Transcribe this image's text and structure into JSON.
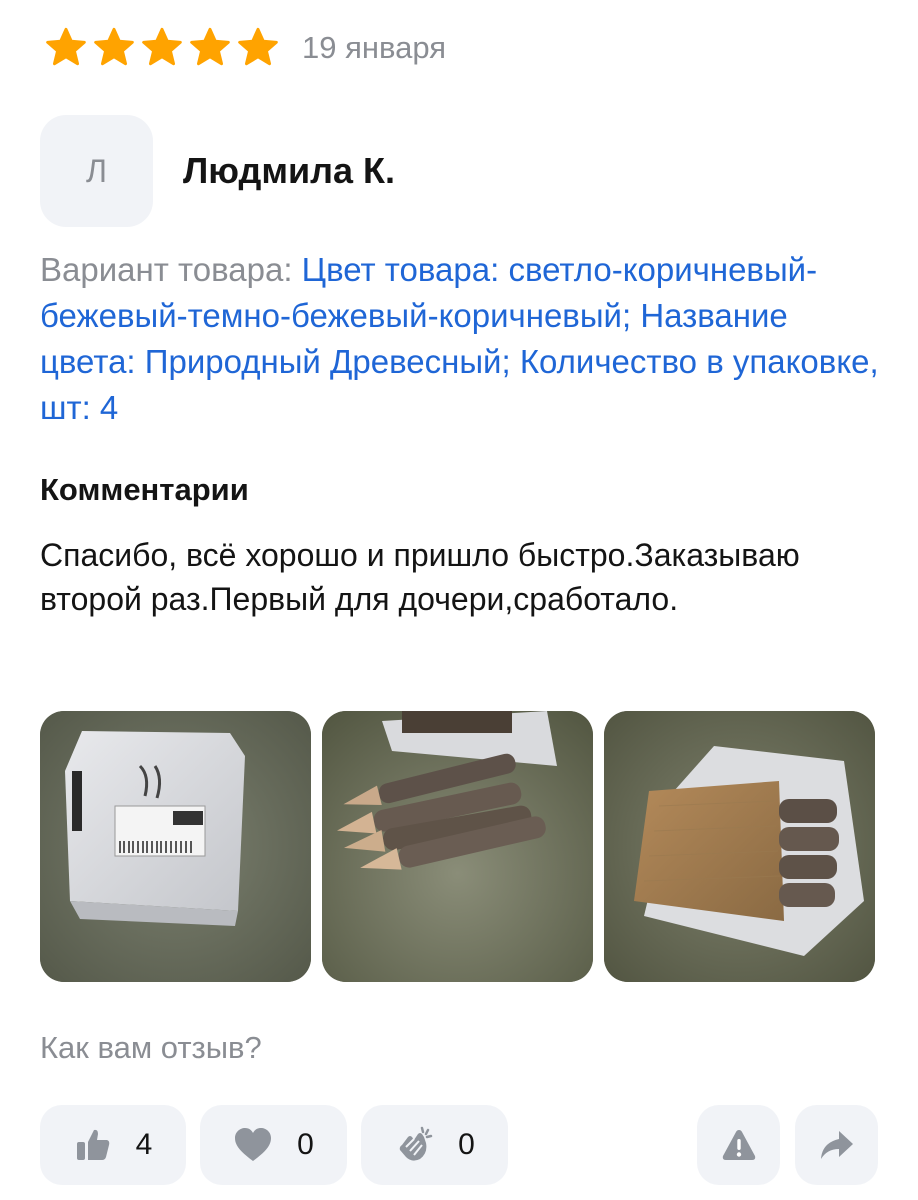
{
  "review": {
    "rating": 5,
    "max_rating": 5,
    "date": "19 января",
    "author": {
      "initial": "Л",
      "name": "Людмила К."
    },
    "variant": {
      "label": "Вариант товара:",
      "value": "Цвет товара: светло-коричневый-бежевый-темно-бежевый-коричневый; Название цвета: Природный Древесный; Количество в упаковке, шт: 4"
    },
    "comments_heading": "Комментарии",
    "comment": "Спасибо, всё хорошо и пришло быстро.Заказываю второй раз.Первый для дочери,сработало.",
    "photos": [
      {
        "icon": "package-photo"
      },
      {
        "icon": "pencils-photo"
      },
      {
        "icon": "pencils-in-box-photo"
      }
    ],
    "feedback_question": "Как вам отзыв?",
    "reactions": {
      "like": {
        "icon": "thumbs-up-icon",
        "count": "4"
      },
      "heart": {
        "icon": "heart-icon",
        "count": "0"
      },
      "clap": {
        "icon": "clapping-hands-icon",
        "count": "0"
      },
      "report": {
        "icon": "warning-icon"
      },
      "share": {
        "icon": "share-arrow-icon"
      }
    }
  },
  "colors": {
    "star": "#ffa300",
    "link": "#1f66d6",
    "muted": "#8a8d93",
    "chip_bg": "#f1f3f7",
    "icon": "#8f949c"
  }
}
